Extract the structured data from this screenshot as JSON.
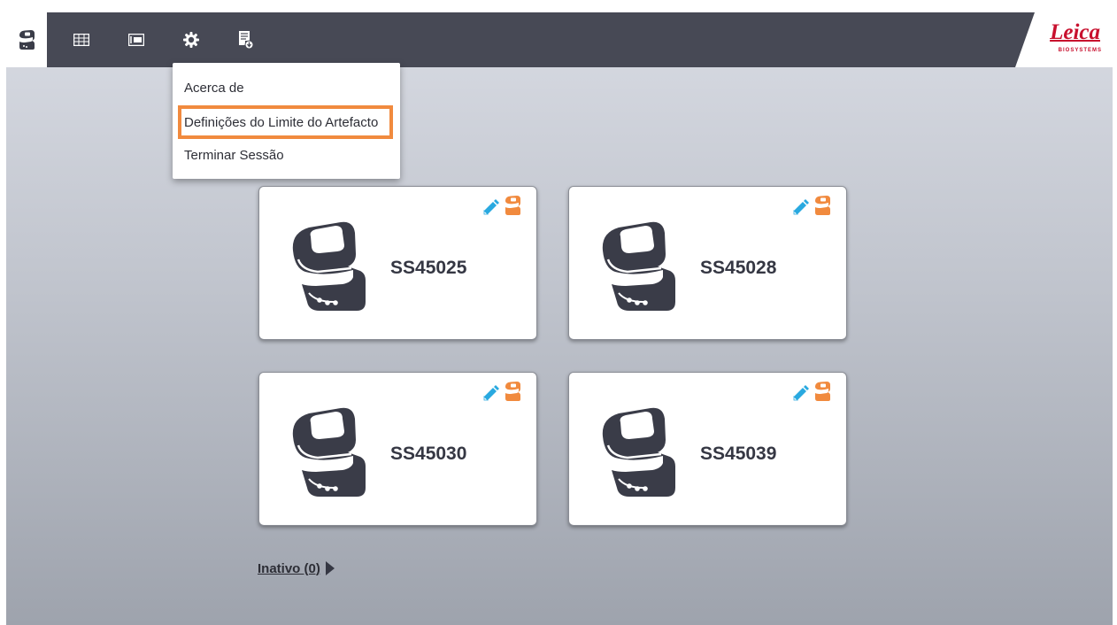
{
  "nav": {
    "items": [
      {
        "icon": "instrument-icon",
        "active": true
      },
      {
        "icon": "slide-grid-icon",
        "active": false
      },
      {
        "icon": "slide-tray-icon",
        "active": false
      },
      {
        "icon": "gear-icon",
        "active": false
      },
      {
        "icon": "report-download-icon",
        "active": false
      }
    ]
  },
  "brand": {
    "name": "Leica",
    "subtitle": "BIOSYSTEMS",
    "color": "#c8102e"
  },
  "menu": {
    "items": [
      {
        "label": "Acerca de"
      },
      {
        "label": "Definições do Limite do Artefacto",
        "highlighted": true
      },
      {
        "label": "Terminar Sessão"
      }
    ]
  },
  "instruments": [
    {
      "name": "SS45025"
    },
    {
      "name": "SS45028"
    },
    {
      "name": "SS45030"
    },
    {
      "name": "SS45039"
    }
  ],
  "inactive": {
    "label": "Inativo (0)"
  },
  "colors": {
    "topbar": "#474955",
    "accent": "#f18a3e",
    "pen": "#29a9e0",
    "instrument": "#3a3c48"
  }
}
